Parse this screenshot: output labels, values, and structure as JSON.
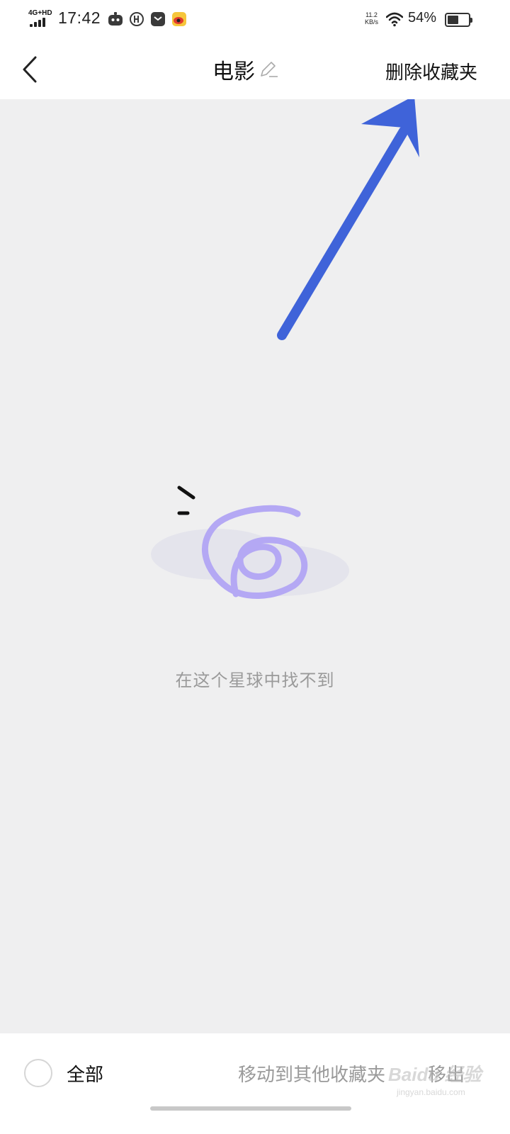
{
  "status_bar": {
    "network": "4G+HD",
    "time": "17:42",
    "net_speed_value": "11.2",
    "net_speed_unit": "KB/s",
    "battery_percent": "54%",
    "battery_level": 0.54,
    "app_icons": [
      "robot-app-icon",
      "circle-app-icon",
      "mail-app-icon",
      "weibo-app-icon"
    ]
  },
  "nav": {
    "title": "电影",
    "delete_label": "删除收藏夹"
  },
  "empty_state": {
    "message": "在这个星球中找不到"
  },
  "bottom_bar": {
    "select_all_label": "全部",
    "move_label": "移动到其他收藏夹",
    "remove_label": "移出"
  },
  "watermark": {
    "logo": "Baidu 经验",
    "url": "jingyan.baidu.com"
  },
  "colors": {
    "content_bg": "#efeff0",
    "arrow": "#3f63d9",
    "illustration_stroke": "#b4a8f4",
    "muted_text": "#9a9a9a"
  }
}
